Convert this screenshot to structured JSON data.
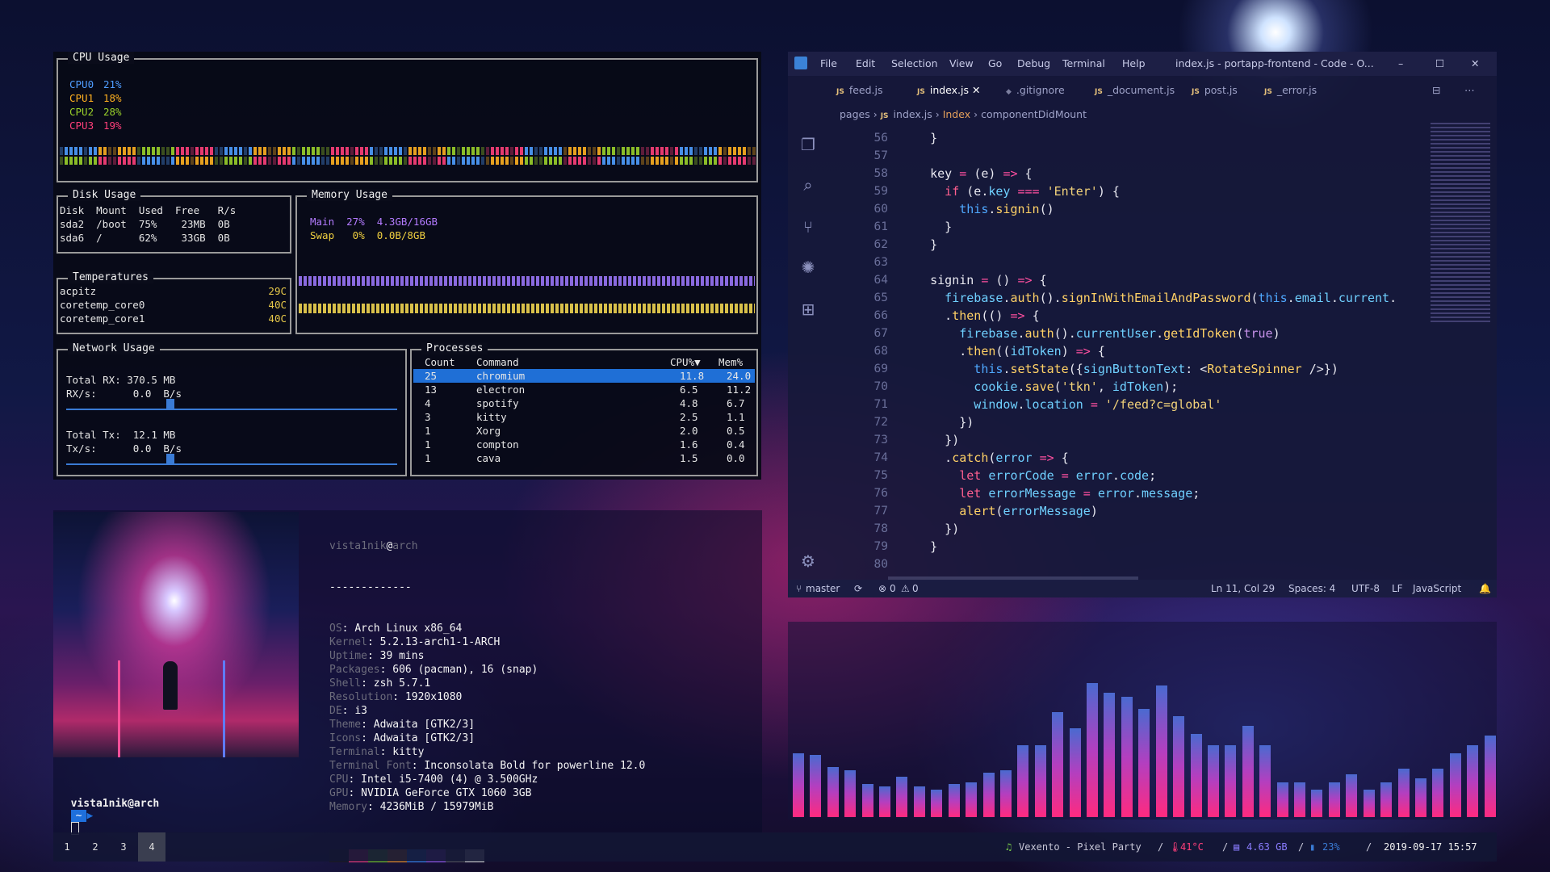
{
  "gotop": {
    "cpu": {
      "title": "CPU Usage",
      "cores": [
        {
          "label": "CPU0",
          "value": "21%",
          "color": "#4f9dff"
        },
        {
          "label": "CPU1",
          "value": "18%",
          "color": "#ffb020"
        },
        {
          "label": "CPU2",
          "value": "28%",
          "color": "#9ad02a"
        },
        {
          "label": "CPU3",
          "value": "19%",
          "color": "#ff3f7a"
        }
      ]
    },
    "disk": {
      "title": "Disk Usage",
      "header": "Disk  Mount  Used  Free   R/s",
      "rows": [
        "sda2  /boot  75%    23MB  0B",
        "sda6  /      62%    33GB  0B"
      ]
    },
    "memory": {
      "title": "Memory Usage",
      "main": "Main  27%  4.3GB/16GB",
      "swap": "Swap   0%  0.0B/8GB"
    },
    "temps": {
      "title": "Temperatures",
      "rows": [
        {
          "name": "acpitz",
          "value": "29C"
        },
        {
          "name": "coretemp_core0",
          "value": "40C"
        },
        {
          "name": "coretemp_core1",
          "value": "40C"
        }
      ]
    },
    "network": {
      "title": "Network Usage",
      "rx_total": "Total RX: 370.5 MB",
      "rx_rate": "RX/s:      0.0  B/s",
      "tx_total": "Total Tx:  12.1 MB",
      "tx_rate": "Tx/s:      0.0  B/s"
    },
    "processes": {
      "title": "Processes",
      "headers": [
        "Count",
        "Command",
        "CPU%▼",
        "Mem%"
      ],
      "rows": [
        [
          "25",
          "chromium",
          "11.8",
          "24.0"
        ],
        [
          "13",
          "electron",
          "6.5",
          "11.2"
        ],
        [
          "4",
          "spotify",
          "4.8",
          "6.7"
        ],
        [
          "3",
          "kitty",
          "2.5",
          "1.1"
        ],
        [
          "1",
          "Xorg",
          "2.0",
          "0.5"
        ],
        [
          "1",
          "compton",
          "1.6",
          "0.4"
        ],
        [
          "1",
          "cava",
          "1.5",
          "0.0"
        ]
      ]
    }
  },
  "neofetch": {
    "user": "vista1nik",
    "at": "@",
    "host": "arch",
    "sep": "-------------",
    "fields": [
      {
        "k": "OS",
        "v": "Arch Linux x86_64"
      },
      {
        "k": "Kernel",
        "v": "5.2.13-arch1-1-ARCH"
      },
      {
        "k": "Uptime",
        "v": "39 mins"
      },
      {
        "k": "Packages",
        "v": "606 (pacman), 16 (snap)"
      },
      {
        "k": "Shell",
        "v": "zsh 5.7.1"
      },
      {
        "k": "Resolution",
        "v": "1920x1080"
      },
      {
        "k": "DE",
        "v": "i3"
      },
      {
        "k": "Theme",
        "v": "Adwaita [GTK2/3]"
      },
      {
        "k": "Icons",
        "v": "Adwaita [GTK2/3]"
      },
      {
        "k": "Terminal",
        "v": "kitty"
      },
      {
        "k": "Terminal Font",
        "v": "Inconsolata Bold for powerline 12.0"
      },
      {
        "k": "CPU",
        "v": "Intel i5-7400 (4) @ 3.500GHz"
      },
      {
        "k": "GPU",
        "v": "NVIDIA GeForce GTX 1060 3GB"
      },
      {
        "k": "Memory",
        "v": "4236MiB / 15979MiB"
      }
    ],
    "palette": [
      "#1a1a22",
      "#ff3f86",
      "#7bd22a",
      "#ff9a2a",
      "#3a8cff",
      "#a060ff",
      "#54545c",
      "#d8d8d8"
    ],
    "prompt_user": "vista1nik@arch",
    "prompt_dir": "~"
  },
  "vscode": {
    "menu": [
      "File",
      "Edit",
      "Selection",
      "View",
      "Go",
      "Debug",
      "Terminal",
      "Help"
    ],
    "title": "index.js - portapp-frontend - Code - O...",
    "tabs": [
      {
        "label": "feed.js",
        "js": true
      },
      {
        "label": "index.js",
        "js": true,
        "active": true
      },
      {
        "label": ".gitignore",
        "js": false
      },
      {
        "label": "_document.js",
        "js": true
      },
      {
        "label": "post.js",
        "js": true
      },
      {
        "label": "_error.js",
        "js": true
      }
    ],
    "breadcrumb": [
      "pages",
      "index.js",
      "Index",
      "componentDidMount"
    ],
    "line_numbers": [
      "56",
      "57",
      "58",
      "59",
      "60",
      "61",
      "62",
      "63",
      "64",
      "65",
      "66",
      "67",
      "68",
      "69",
      "70",
      "71",
      "72",
      "73",
      "74",
      "75",
      "76",
      "77",
      "78",
      "79",
      "80"
    ],
    "code": [
      [
        [
          "c-w",
          "    }"
        ]
      ],
      [
        [
          "c-w",
          ""
        ]
      ],
      [
        [
          "c-w",
          "    key "
        ],
        [
          "c-p",
          "= "
        ],
        [
          "c-w",
          "(e) "
        ],
        [
          "c-p",
          "=> "
        ],
        [
          "c-w",
          "{"
        ]
      ],
      [
        [
          "c-k",
          "      if "
        ],
        [
          "c-w",
          "(e."
        ],
        [
          "c-c",
          "key "
        ],
        [
          "c-p",
          "=== "
        ],
        [
          "c-s",
          "'Enter'"
        ],
        [
          "c-w",
          ") {"
        ]
      ],
      [
        [
          "c-b",
          "        this"
        ],
        [
          "c-w",
          "."
        ],
        [
          "c-y",
          "signin"
        ],
        [
          "c-w",
          "()"
        ]
      ],
      [
        [
          "c-w",
          "      }"
        ]
      ],
      [
        [
          "c-w",
          "    }"
        ]
      ],
      [
        [
          "c-w",
          ""
        ]
      ],
      [
        [
          "c-w",
          "    signin "
        ],
        [
          "c-p",
          "= "
        ],
        [
          "c-w",
          "() "
        ],
        [
          "c-p",
          "=> "
        ],
        [
          "c-w",
          "{"
        ]
      ],
      [
        [
          "c-c",
          "      firebase"
        ],
        [
          "c-w",
          "."
        ],
        [
          "c-y",
          "auth"
        ],
        [
          "c-w",
          "()."
        ],
        [
          "c-y",
          "signInWithEmailAndPassword"
        ],
        [
          "c-w",
          "("
        ],
        [
          "c-b",
          "this"
        ],
        [
          "c-w",
          "."
        ],
        [
          "c-c",
          "email"
        ],
        [
          "c-w",
          "."
        ],
        [
          "c-c",
          "current"
        ],
        [
          "c-w",
          "."
        ]
      ],
      [
        [
          "c-w",
          "      ."
        ],
        [
          "c-y",
          "then"
        ],
        [
          "c-w",
          "(() "
        ],
        [
          "c-p",
          "=> "
        ],
        [
          "c-w",
          "{"
        ]
      ],
      [
        [
          "c-c",
          "        firebase"
        ],
        [
          "c-w",
          "."
        ],
        [
          "c-y",
          "auth"
        ],
        [
          "c-w",
          "()."
        ],
        [
          "c-c",
          "currentUser"
        ],
        [
          "c-w",
          "."
        ],
        [
          "c-y",
          "getIdToken"
        ],
        [
          "c-w",
          "("
        ],
        [
          "c-g",
          "true"
        ],
        [
          "c-w",
          ")"
        ]
      ],
      [
        [
          "c-w",
          "        ."
        ],
        [
          "c-y",
          "then"
        ],
        [
          "c-w",
          "(("
        ],
        [
          "c-c",
          "idToken"
        ],
        [
          "c-w",
          ") "
        ],
        [
          "c-p",
          "=> "
        ],
        [
          "c-w",
          "{"
        ]
      ],
      [
        [
          "c-b",
          "          this"
        ],
        [
          "c-w",
          "."
        ],
        [
          "c-y",
          "setState"
        ],
        [
          "c-w",
          "({"
        ],
        [
          "c-c",
          "signButtonText"
        ],
        [
          "c-w",
          ": <"
        ],
        [
          "c-y",
          "RotateSpinner "
        ],
        [
          "c-w",
          "/>})"
        ]
      ],
      [
        [
          "c-c",
          "          cookie"
        ],
        [
          "c-w",
          "."
        ],
        [
          "c-y",
          "save"
        ],
        [
          "c-w",
          "("
        ],
        [
          "c-s",
          "'tkn'"
        ],
        [
          "c-w",
          ", "
        ],
        [
          "c-c",
          "idToken"
        ],
        [
          "c-w",
          ");"
        ]
      ],
      [
        [
          "c-c",
          "          window"
        ],
        [
          "c-w",
          "."
        ],
        [
          "c-c",
          "location "
        ],
        [
          "c-p",
          "= "
        ],
        [
          "c-s",
          "'/feed?c=global'"
        ]
      ],
      [
        [
          "c-w",
          "        })"
        ]
      ],
      [
        [
          "c-w",
          "      })"
        ]
      ],
      [
        [
          "c-w",
          "      ."
        ],
        [
          "c-y",
          "catch"
        ],
        [
          "c-w",
          "("
        ],
        [
          "c-c",
          "error "
        ],
        [
          "c-p",
          "=> "
        ],
        [
          "c-w",
          "{"
        ]
      ],
      [
        [
          "c-k",
          "        let "
        ],
        [
          "c-c",
          "errorCode "
        ],
        [
          "c-p",
          "= "
        ],
        [
          "c-c",
          "error"
        ],
        [
          "c-w",
          "."
        ],
        [
          "c-c",
          "code"
        ],
        [
          "c-w",
          ";"
        ]
      ],
      [
        [
          "c-k",
          "        let "
        ],
        [
          "c-c",
          "errorMessage "
        ],
        [
          "c-p",
          "= "
        ],
        [
          "c-c",
          "error"
        ],
        [
          "c-w",
          "."
        ],
        [
          "c-c",
          "message"
        ],
        [
          "c-w",
          ";"
        ]
      ],
      [
        [
          "c-y",
          "        alert"
        ],
        [
          "c-w",
          "("
        ],
        [
          "c-c",
          "errorMessage"
        ],
        [
          "c-w",
          ")"
        ]
      ],
      [
        [
          "c-w",
          "      })"
        ]
      ],
      [
        [
          "c-w",
          "    }"
        ]
      ],
      [
        [
          "c-w",
          ""
        ]
      ]
    ],
    "status": {
      "branch": "master",
      "errors": "0",
      "warnings": "0",
      "position": "Ln 11, Col 29",
      "spaces": "Spaces: 4",
      "encoding": "UTF-8",
      "eol": "LF",
      "language": "JavaScript"
    }
  },
  "visualizer": {
    "levels": [
      0.33,
      0.32,
      0.26,
      0.24,
      0.17,
      0.16,
      0.21,
      0.16,
      0.14,
      0.17,
      0.18,
      0.23,
      0.24,
      0.37,
      0.37,
      0.54,
      0.46,
      0.69,
      0.64,
      0.62,
      0.56,
      0.68,
      0.52,
      0.43,
      0.37,
      0.37,
      0.47,
      0.37,
      0.18,
      0.18,
      0.14,
      0.18,
      0.22,
      0.14,
      0.18,
      0.25,
      0.2,
      0.25,
      0.33,
      0.37,
      0.42
    ]
  },
  "panel": {
    "workspaces": [
      "1",
      "2",
      "3",
      "4"
    ],
    "active_workspace": "4",
    "music": "Vexento - Pixel Party",
    "temp": "41°C",
    "memory": "4.63 GB",
    "battery": "23%",
    "datetime": "2019-09-17 15:57",
    "sep": "/"
  }
}
